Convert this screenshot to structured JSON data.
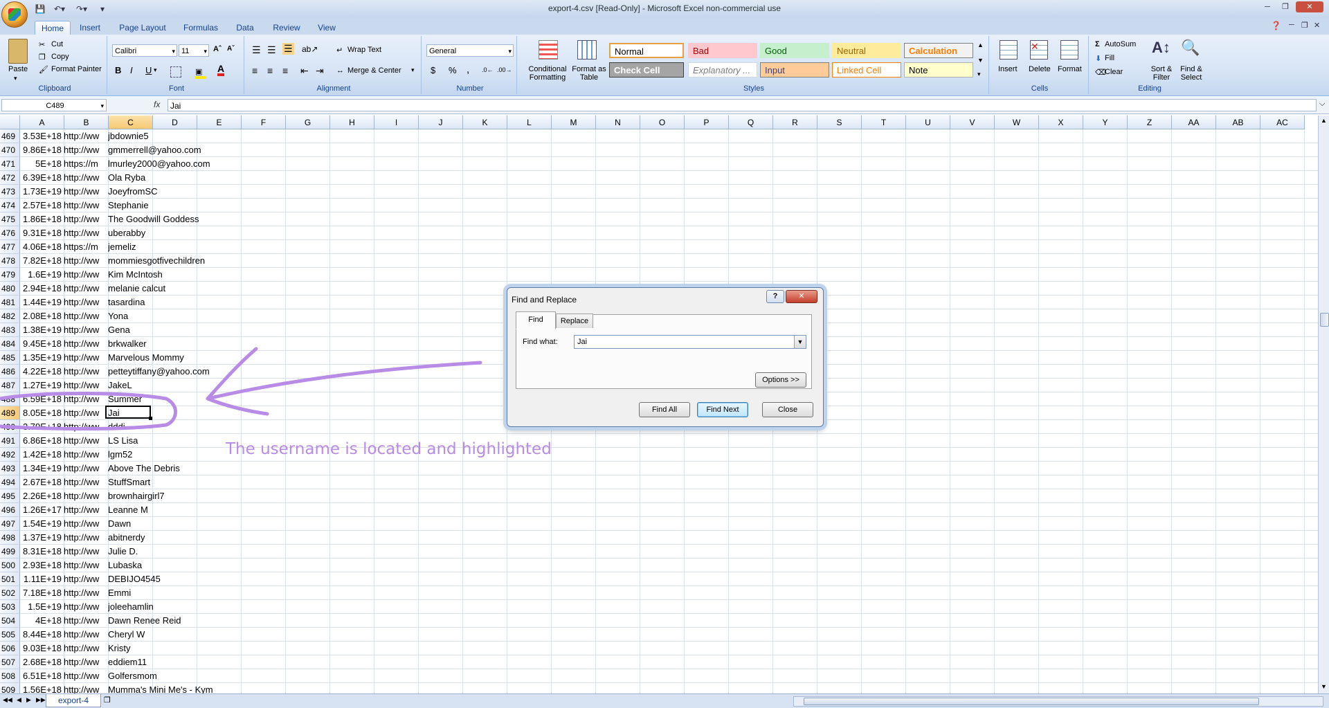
{
  "window": {
    "title": "export-4.csv  [Read-Only] - Microsoft Excel non-commercial use"
  },
  "ribbon_tabs": [
    "Home",
    "Insert",
    "Page Layout",
    "Formulas",
    "Data",
    "Review",
    "View"
  ],
  "clipboard": {
    "paste": "Paste",
    "cut": "Cut",
    "copy": "Copy",
    "format_painter": "Format Painter",
    "label": "Clipboard"
  },
  "font": {
    "name": "Calibri",
    "size": "11",
    "label": "Font",
    "bold": "B",
    "italic": "I",
    "underline": "U"
  },
  "alignment": {
    "wrap": "Wrap Text",
    "merge": "Merge & Center",
    "label": "Alignment"
  },
  "number": {
    "format": "General",
    "currency": "$",
    "percent": "%",
    "comma": ",",
    "label": "Number"
  },
  "styles": {
    "conditional": "Conditional Formatting",
    "format_table": "Format as Table",
    "label": "Styles",
    "cells": [
      {
        "name": "Normal",
        "bg": "#ffffff",
        "fg": "#000000",
        "border": "#e8a040"
      },
      {
        "name": "Bad",
        "bg": "#ffc7ce",
        "fg": "#9c0006",
        "border": "#ffc7ce"
      },
      {
        "name": "Good",
        "bg": "#c6efce",
        "fg": "#006100",
        "border": "#c6efce"
      },
      {
        "name": "Neutral",
        "bg": "#ffeb9c",
        "fg": "#9c6500",
        "border": "#ffeb9c"
      },
      {
        "name": "Calculation",
        "bg": "#f2f2f2",
        "fg": "#fa7d00",
        "border": "#7f7f7f"
      },
      {
        "name": "Check Cell",
        "bg": "#a5a5a5",
        "fg": "#ffffff",
        "border": "#3f3f3f"
      },
      {
        "name": "Explanatory ...",
        "bg": "#ffffff",
        "fg": "#7f7f7f",
        "border": "#d0d8e4"
      },
      {
        "name": "Input",
        "bg": "#ffcc99",
        "fg": "#3f3f76",
        "border": "#7f7f7f"
      },
      {
        "name": "Linked Cell",
        "bg": "#ffffff",
        "fg": "#fa7d00",
        "border": "#ff8001"
      },
      {
        "name": "Note",
        "bg": "#ffffcc",
        "fg": "#000000",
        "border": "#b2b2b2"
      }
    ]
  },
  "cells_group": {
    "insert": "Insert",
    "delete": "Delete",
    "format": "Format",
    "label": "Cells"
  },
  "editing": {
    "autosum": "AutoSum",
    "fill": "Fill",
    "clear": "Clear",
    "sort": "Sort & Filter",
    "find": "Find & Select",
    "label": "Editing"
  },
  "formula_bar": {
    "name_box": "C489",
    "fx": "fx",
    "value": "Jai"
  },
  "columns": [
    "A",
    "B",
    "C",
    "D",
    "E",
    "F",
    "G",
    "H",
    "I",
    "J",
    "K",
    "L",
    "M",
    "N",
    "O",
    "P",
    "Q",
    "R",
    "S",
    "T",
    "U",
    "V",
    "W",
    "X",
    "Y",
    "Z",
    "AA",
    "AB",
    "AC"
  ],
  "rows": [
    {
      "n": "469",
      "a": "3.53E+18",
      "b": "http://ww",
      "c": "jbdownie5"
    },
    {
      "n": "470",
      "a": "9.86E+18",
      "b": "http://ww",
      "c": "gmmerrell@yahoo.com"
    },
    {
      "n": "471",
      "a": "5E+18",
      "b": "https://m",
      "c": "lmurley2000@yahoo.com"
    },
    {
      "n": "472",
      "a": "6.39E+18",
      "b": "http://ww",
      "c": "Ola Ryba"
    },
    {
      "n": "473",
      "a": "1.73E+19",
      "b": "http://ww",
      "c": "JoeyfromSC"
    },
    {
      "n": "474",
      "a": "2.57E+18",
      "b": "http://ww",
      "c": "Stephanie"
    },
    {
      "n": "475",
      "a": "1.86E+18",
      "b": "http://ww",
      "c": "The Goodwill Goddess"
    },
    {
      "n": "476",
      "a": "9.31E+18",
      "b": "http://ww",
      "c": "uberabby"
    },
    {
      "n": "477",
      "a": "4.06E+18",
      "b": "https://m",
      "c": "jemeliz"
    },
    {
      "n": "478",
      "a": "7.82E+18",
      "b": "http://ww",
      "c": "mommiesgotfivechildren"
    },
    {
      "n": "479",
      "a": "1.6E+19",
      "b": "http://ww",
      "c": "Kim McIntosh"
    },
    {
      "n": "480",
      "a": "2.94E+18",
      "b": "http://ww",
      "c": "melanie calcut"
    },
    {
      "n": "481",
      "a": "1.44E+19",
      "b": "http://ww",
      "c": "tasardina"
    },
    {
      "n": "482",
      "a": "2.08E+18",
      "b": "http://ww",
      "c": "Yona"
    },
    {
      "n": "483",
      "a": "1.38E+19",
      "b": "http://ww",
      "c": "Gena"
    },
    {
      "n": "484",
      "a": "9.45E+18",
      "b": "http://ww",
      "c": "brkwalker"
    },
    {
      "n": "485",
      "a": "1.35E+19",
      "b": "http://ww",
      "c": "Marvelous Mommy"
    },
    {
      "n": "486",
      "a": "4.22E+18",
      "b": "http://ww",
      "c": "petteytiffany@yahoo.com"
    },
    {
      "n": "487",
      "a": "1.27E+19",
      "b": "http://ww",
      "c": "JakeL"
    },
    {
      "n": "488",
      "a": "6.59E+18",
      "b": "http://ww",
      "c": "Summer"
    },
    {
      "n": "489",
      "a": "8.05E+18",
      "b": "http://ww",
      "c": "Jai"
    },
    {
      "n": "490",
      "a": "3.79E+18",
      "b": "http://ww",
      "c": "dddi"
    },
    {
      "n": "491",
      "a": "6.86E+18",
      "b": "http://ww",
      "c": "LS Lisa"
    },
    {
      "n": "492",
      "a": "1.42E+18",
      "b": "http://ww",
      "c": "lgm52"
    },
    {
      "n": "493",
      "a": "1.34E+19",
      "b": "http://ww",
      "c": "Above The Debris"
    },
    {
      "n": "494",
      "a": "2.67E+18",
      "b": "http://ww",
      "c": "StuffSmart"
    },
    {
      "n": "495",
      "a": "2.26E+18",
      "b": "http://ww",
      "c": "brownhairgirl7"
    },
    {
      "n": "496",
      "a": "1.26E+17",
      "b": "http://ww",
      "c": "Leanne M"
    },
    {
      "n": "497",
      "a": "1.54E+19",
      "b": "http://ww",
      "c": "Dawn"
    },
    {
      "n": "498",
      "a": "1.37E+19",
      "b": "http://ww",
      "c": "abitnerdy"
    },
    {
      "n": "499",
      "a": "8.31E+18",
      "b": "http://ww",
      "c": "Julie D."
    },
    {
      "n": "500",
      "a": "2.93E+18",
      "b": "http://ww",
      "c": "Lubaska"
    },
    {
      "n": "501",
      "a": "1.11E+19",
      "b": "http://ww",
      "c": "DEBIJO4545"
    },
    {
      "n": "502",
      "a": "7.18E+18",
      "b": "http://ww",
      "c": "Emmi"
    },
    {
      "n": "503",
      "a": "1.5E+19",
      "b": "http://ww",
      "c": "joleehamlin"
    },
    {
      "n": "504",
      "a": "4E+18",
      "b": "http://ww",
      "c": "Dawn  Renee Reid"
    },
    {
      "n": "505",
      "a": "8.44E+18",
      "b": "http://ww",
      "c": "Cheryl W"
    },
    {
      "n": "506",
      "a": "9.03E+18",
      "b": "http://ww",
      "c": "Kristy"
    },
    {
      "n": "507",
      "a": "2.68E+18",
      "b": "http://ww",
      "c": "eddiem11"
    },
    {
      "n": "508",
      "a": "6.51E+18",
      "b": "http://ww",
      "c": "Golfersmom"
    },
    {
      "n": "509",
      "a": "1.56E+18",
      "b": "http://ww",
      "c": "Mumma's Mini Me's - Kym"
    }
  ],
  "selected": {
    "row": "489",
    "col": "C"
  },
  "sheet_tab": "export-4",
  "dialog": {
    "title": "Find and Replace",
    "help": "?",
    "close_x": "✕",
    "tab_find": "Find",
    "tab_replace": "Replace",
    "find_label": "Find what:",
    "find_value": "Jai",
    "options": "Options >>",
    "find_all": "Find All",
    "find_next": "Find Next",
    "close": "Close"
  },
  "annotation": {
    "text": "The username is located and highlighted",
    "color": "#b78be6"
  }
}
